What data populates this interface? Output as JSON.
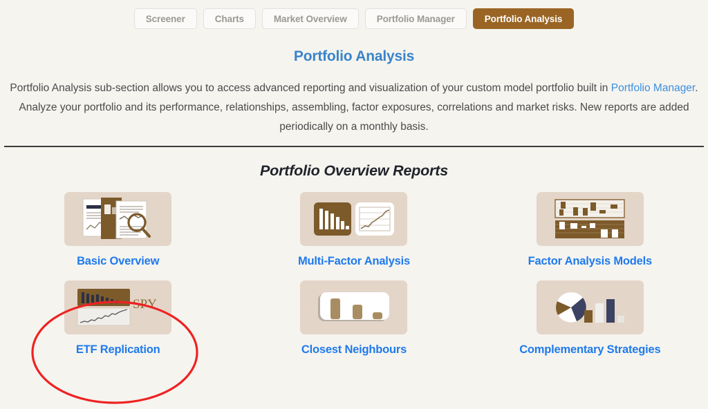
{
  "tabs": [
    {
      "label": "Screener",
      "active": false
    },
    {
      "label": "Charts",
      "active": false
    },
    {
      "label": "Market Overview",
      "active": false
    },
    {
      "label": "Portfolio Manager",
      "active": false
    },
    {
      "label": "Portfolio Analysis",
      "active": true
    }
  ],
  "page_title": "Portfolio Analysis",
  "description": {
    "part1": "Portfolio Analysis sub-section allows you to access advanced reporting and visualization of your custom model portfolio built in ",
    "link": "Portfolio Manager",
    "part2": ". Analyze your portfolio and its performance, relationships, assembling, factor exposures, correlations and market risks. New reports are added periodically on a monthly basis."
  },
  "section_heading": "Portfolio Overview Reports",
  "cards": [
    {
      "label": "Basic Overview",
      "icon": "documents-magnifier-icon"
    },
    {
      "label": "Multi-Factor Analysis",
      "icon": "bar-and-line-chart-icon"
    },
    {
      "label": "Factor Analysis Models",
      "icon": "dual-heatmap-panels-icon"
    },
    {
      "label": "ETF Replication",
      "icon": "spy-benchmark-chart-icon",
      "thumb_text": "SPY",
      "annotated": true
    },
    {
      "label": "Closest Neighbours",
      "icon": "descending-bars-icon"
    },
    {
      "label": "Complementary Strategies",
      "icon": "pie-and-bars-icon"
    }
  ],
  "annotation": {
    "shape": "ellipse",
    "color": "#ee2222",
    "target": "ETF Replication"
  },
  "colors": {
    "page_background": "#f5f4ef",
    "accent_brown": "#9a6524",
    "link_blue": "#1f7aed",
    "title_blue": "#3a84c9",
    "thumb_background": "#e3d5c8",
    "annotation_red": "#ee2222"
  }
}
